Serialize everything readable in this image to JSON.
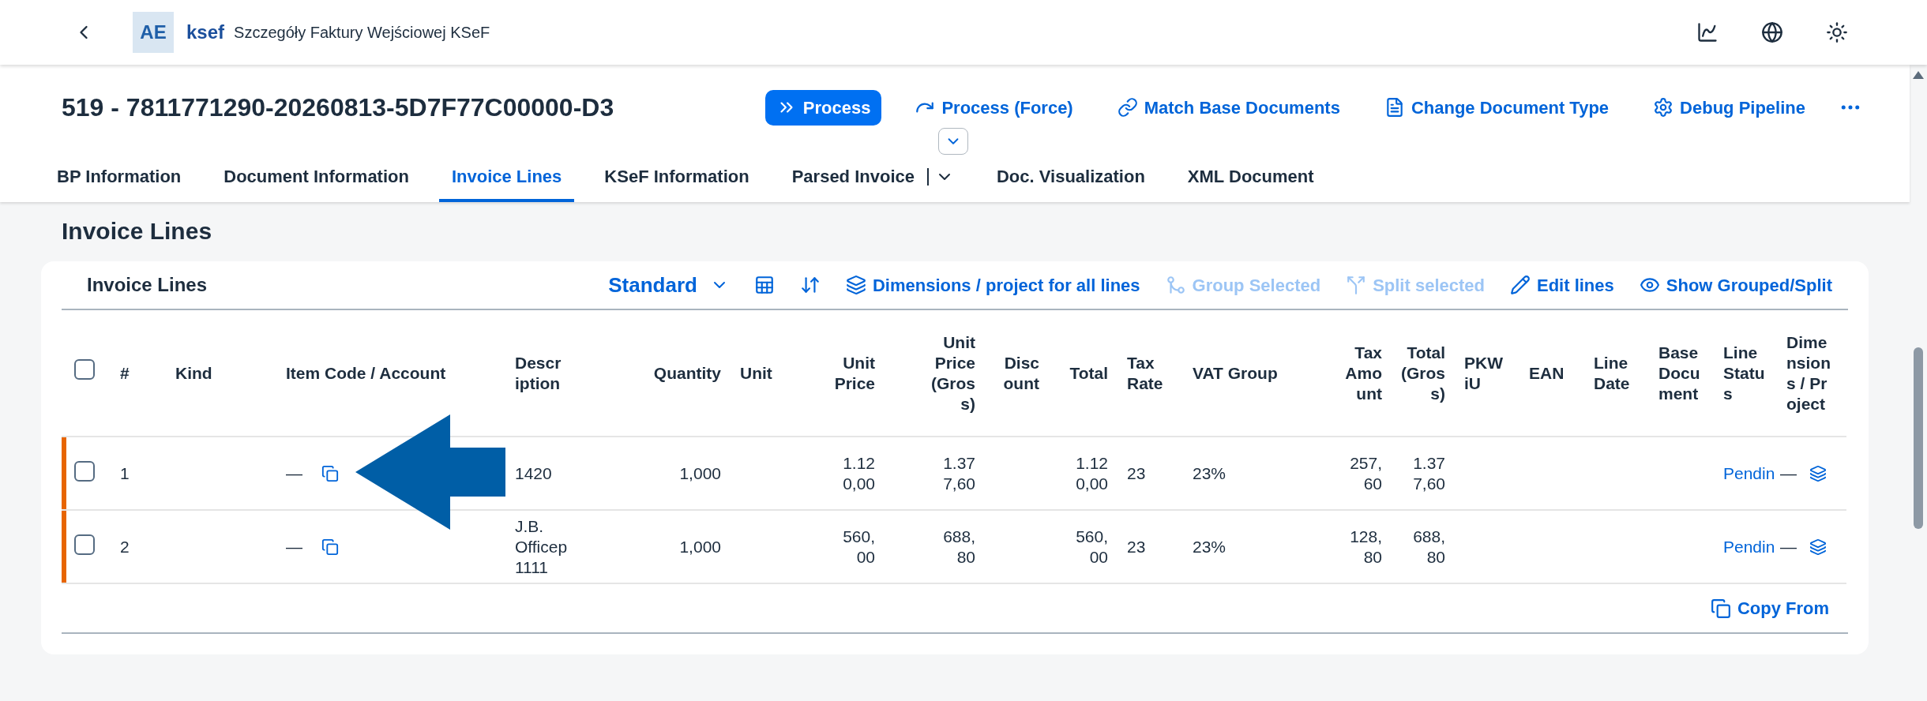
{
  "shell": {
    "logo": "AE",
    "app": "ksef",
    "subtitle": "Szczegóły Faktury Wejściowej KSeF"
  },
  "header": {
    "title": "519 - 7811771290-20260813-5D7F77C00000-D3",
    "actions": [
      {
        "label": "Process",
        "emphasized": true
      },
      {
        "label": "Process (Force)",
        "emphasized": false
      },
      {
        "label": "Match Base Documents",
        "emphasized": false
      },
      {
        "label": "Change Document Type",
        "emphasized": false
      },
      {
        "label": "Debug Pipeline",
        "emphasized": false
      }
    ]
  },
  "tabs": [
    {
      "label": "BP Information",
      "selected": false,
      "has_menu": false
    },
    {
      "label": "Document Information",
      "selected": false,
      "has_menu": false
    },
    {
      "label": "Invoice Lines",
      "selected": true,
      "has_menu": false
    },
    {
      "label": "KSeF Information",
      "selected": false,
      "has_menu": false
    },
    {
      "label": "Parsed Invoice",
      "selected": false,
      "has_menu": true
    },
    {
      "label": "Doc. Visualization",
      "selected": false,
      "has_menu": false
    },
    {
      "label": "XML Document",
      "selected": false,
      "has_menu": false
    }
  ],
  "section_title": "Invoice Lines",
  "table": {
    "title": "Invoice Lines",
    "variant": "Standard",
    "toolbar": [
      {
        "label": "Dimensions / project for all lines",
        "disabled": false
      },
      {
        "label": "Group Selected",
        "disabled": true
      },
      {
        "label": "Split selected",
        "disabled": true
      },
      {
        "label": "Edit lines",
        "disabled": false
      },
      {
        "label": "Show Grouped/Split",
        "disabled": false
      }
    ],
    "select_all_checked": false,
    "columns": [
      {
        "label": "#"
      },
      {
        "label": "Kind"
      },
      {
        "label": "Item Code / Account"
      },
      {
        "label": "Description"
      },
      {
        "label": "Quantity"
      },
      {
        "label": "Unit"
      },
      {
        "label": "Unit Price"
      },
      {
        "label": "Unit Price (Gross)"
      },
      {
        "label": "Discount"
      },
      {
        "label": "Total"
      },
      {
        "label": "Tax Rate"
      },
      {
        "label": "VAT Group"
      },
      {
        "label": "Tax Amount"
      },
      {
        "label": "Total (Gross)"
      },
      {
        "label": "PKWiU"
      },
      {
        "label": "EAN"
      },
      {
        "label": "Line Date"
      },
      {
        "label": "Base Document"
      },
      {
        "label": "Line Status"
      },
      {
        "label": "Dimensions / Project"
      }
    ],
    "rows": [
      {
        "checked": false,
        "highlighted": true,
        "number": "1",
        "item_code": "—",
        "description": "1420",
        "quantity": "1,000",
        "unit_price": "1.120,00",
        "unit_price_gross": "1.377,60",
        "total": "1.120,00",
        "tax_rate": "23",
        "vat_group": "23%",
        "tax_amount": "257,60",
        "total_gross": "1.377,60",
        "status": "Pendin",
        "dimensions": "—"
      },
      {
        "checked": false,
        "highlighted": true,
        "number": "2",
        "item_code": "—",
        "description": "J.B. Officep 1111",
        "quantity": "1,000",
        "unit_price": "560,00",
        "unit_price_gross": "688,80",
        "total": "560,00",
        "tax_rate": "23",
        "vat_group": "23%",
        "tax_amount": "128,80",
        "total_gross": "688,80",
        "status": "Pendin",
        "dimensions": "—"
      }
    ],
    "footer_action": "Copy From"
  }
}
